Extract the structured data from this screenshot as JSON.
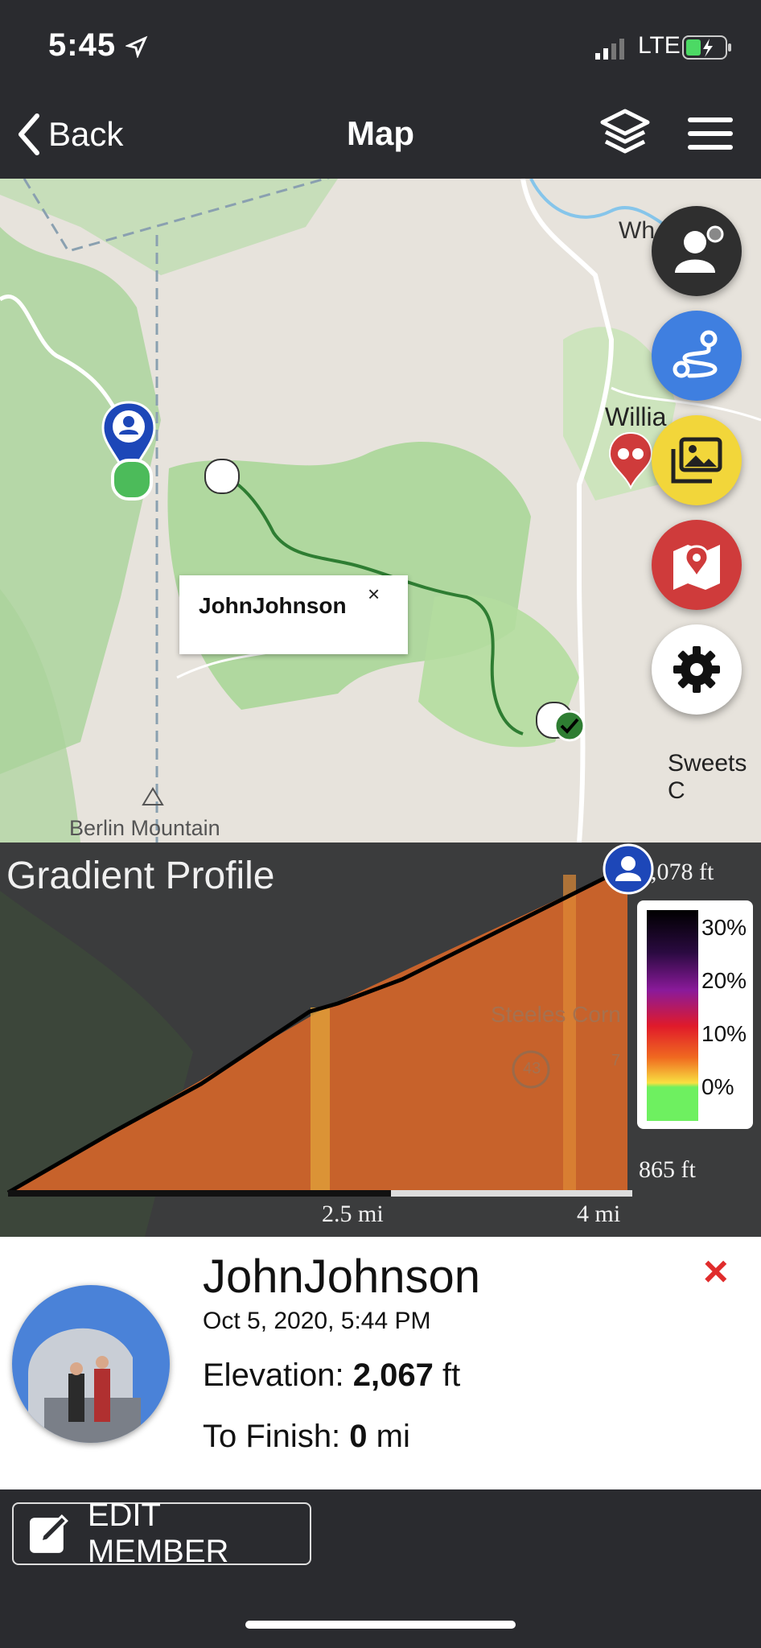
{
  "status_bar": {
    "time": "5:45",
    "network": "LTE"
  },
  "nav": {
    "back_label": "Back",
    "title": "Map"
  },
  "map": {
    "labels": {
      "town_top": "Wh",
      "town_mid": "Willia",
      "town_right": "Sweets C",
      "mountain": "Berlin Mountain"
    },
    "popup": {
      "name": "JohnJohnson",
      "close": "×"
    },
    "fabs": [
      {
        "icon": "person-icon",
        "color": "#2f2f2f"
      },
      {
        "icon": "route-icon",
        "color": "#3f7fe0"
      },
      {
        "icon": "photos-icon",
        "color": "#f2d63a"
      },
      {
        "icon": "map-pin-icon",
        "color": "#cf3b3b"
      },
      {
        "icon": "gear-icon",
        "color": "#ffffff"
      }
    ]
  },
  "gradient_profile": {
    "title": "Gradient Profile",
    "top_elevation": "2,078 ft",
    "bottom_elevation": "865 ft",
    "x_ticks": [
      "2.5 mi",
      "4 mi"
    ],
    "legend": [
      "30%",
      "20%",
      "10%",
      "0%"
    ],
    "map_labels": {
      "town": "Steeles Corn",
      "route_43": "43",
      "route_7": "7"
    }
  },
  "member": {
    "name": "JohnJohnson",
    "date": "Oct 5, 2020, 5:44 PM",
    "elevation_label": "Elevation: ",
    "elevation_value": "2,067",
    "elevation_unit": " ft",
    "finish_label": "To Finish: ",
    "finish_value": "0",
    "finish_unit": " mi",
    "close": "×"
  },
  "edit_button": {
    "label": "EDIT MEMBER"
  },
  "colors": {
    "bar": "#2a2b2f",
    "accent_red": "#e02c2c",
    "route": "#2e7d32",
    "profile": "#c9612a"
  }
}
